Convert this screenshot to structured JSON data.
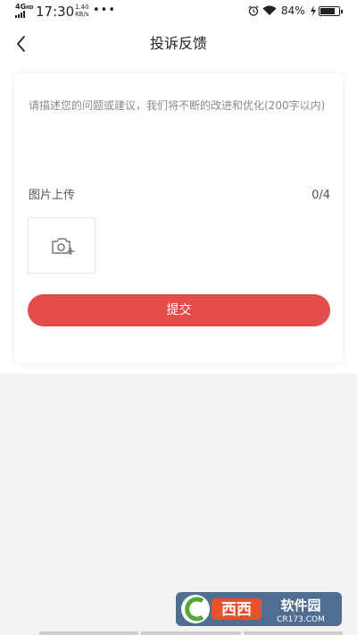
{
  "status_bar": {
    "network": "4G",
    "network_sup": "HD",
    "time": "17:30",
    "speed_value": "1.40",
    "speed_unit": "KB/s",
    "more": "•••",
    "battery_percent": "84%",
    "battery_level": 0.84,
    "icons": [
      "signal-icon",
      "alarm-icon",
      "wifi-icon",
      "charging-icon",
      "battery-icon"
    ]
  },
  "header": {
    "back_icon": "chevron-left-icon",
    "title": "投诉反馈"
  },
  "form": {
    "placeholder": "请描述您的问题或建议，我们将不断的改进和优化(200字以内)",
    "value": "",
    "upload_label": "图片上传",
    "upload_count": "0/4",
    "upload_icon": "camera-plus-icon",
    "submit_label": "提交"
  },
  "colors": {
    "accent": "#e24c4a",
    "background": "#f2f2f2",
    "card": "#ffffff"
  },
  "watermark": {
    "brand": "西西软件园",
    "site": "CR173.COM"
  }
}
